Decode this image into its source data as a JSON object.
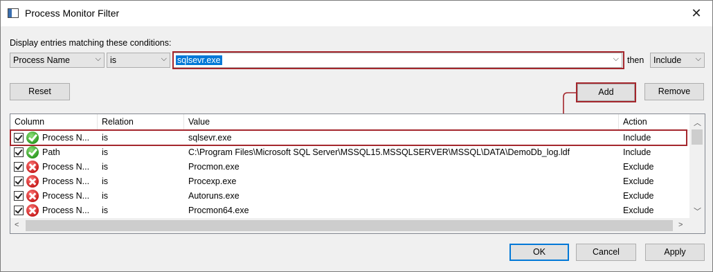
{
  "window": {
    "title": "Process Monitor Filter",
    "close_glyph": "✕"
  },
  "filter": {
    "instruction": "Display entries matching these conditions:",
    "column_value": "Process Name",
    "relation_value": "is",
    "value_text": "sqlsevr.exe",
    "then_label": "then",
    "action_value": "Include"
  },
  "buttons": {
    "reset": "Reset",
    "add": "Add",
    "remove": "Remove",
    "ok": "OK",
    "cancel": "Cancel",
    "apply": "Apply"
  },
  "table": {
    "headers": {
      "column": "Column",
      "relation": "Relation",
      "value": "Value",
      "action": "Action"
    },
    "rows": [
      {
        "column": "Process N...",
        "relation": "is",
        "value": "sqlsevr.exe",
        "action": "Include",
        "status": "include",
        "checked": true
      },
      {
        "column": "Path",
        "relation": "is",
        "value": "C:\\Program Files\\Microsoft SQL Server\\MSSQL15.MSSQLSERVER\\MSSQL\\DATA\\DemoDb_log.ldf",
        "action": "Include",
        "status": "include",
        "checked": true
      },
      {
        "column": "Process N...",
        "relation": "is",
        "value": "Procmon.exe",
        "action": "Exclude",
        "status": "exclude",
        "checked": true
      },
      {
        "column": "Process N...",
        "relation": "is",
        "value": "Procexp.exe",
        "action": "Exclude",
        "status": "exclude",
        "checked": true
      },
      {
        "column": "Process N...",
        "relation": "is",
        "value": "Autoruns.exe",
        "action": "Exclude",
        "status": "exclude",
        "checked": true
      },
      {
        "column": "Process N...",
        "relation": "is",
        "value": "Procmon64.exe",
        "action": "Exclude",
        "status": "exclude",
        "checked": true
      }
    ]
  },
  "colors": {
    "accent": "#0078d7",
    "highlight_annotation": "#a4262c"
  },
  "icons": {
    "include": "green-check-icon",
    "exclude": "red-x-icon"
  }
}
